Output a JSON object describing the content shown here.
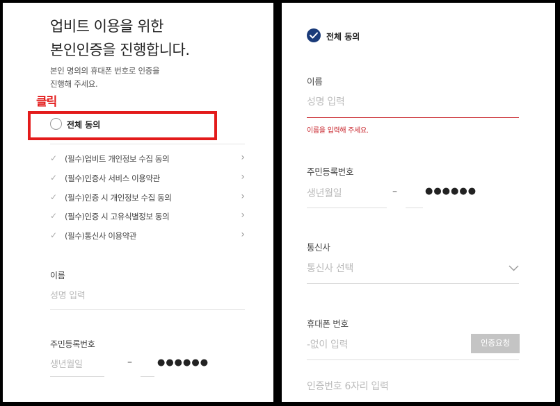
{
  "left": {
    "title_line1": "업비트 이용을 위한",
    "title_line2": "본인인증을 진행합니다.",
    "desc_line1": "본인 명의의 휴대폰 번호로 인증을",
    "desc_line2": "진행해 주세요.",
    "click_annotation": "클릭",
    "all_agree": "전체 동의",
    "terms": [
      "(필수)업비트 개인정보 수집 동의",
      "(필수)인증사 서비스 이용약관",
      "(필수)인증 시 개인정보 수집 동의",
      "(필수)인증 시 고유식별정보 동의",
      "(필수)통신사 이용약관"
    ],
    "name_label": "이름",
    "name_placeholder": "성명 입력",
    "rrn_label": "주민등록번호",
    "rrn_placeholder": "생년월일",
    "rrn_dash": "–",
    "rrn_masked": "●●●●●●"
  },
  "right": {
    "all_agree": "전체 동의",
    "name_label": "이름",
    "name_placeholder": "성명 입력",
    "name_error": "이름을 입력해 주세요.",
    "rrn_label": "주민등록번호",
    "rrn_placeholder": "생년월일",
    "rrn_dash": "–",
    "rrn_masked": "●●●●●●",
    "carrier_label": "통신사",
    "carrier_placeholder": "통신사 선택",
    "phone_label": "휴대폰 번호",
    "phone_placeholder": "-없이 입력",
    "verify_button": "인증요청",
    "code_placeholder": "인증번호 6자리 입력"
  },
  "colors": {
    "highlight_red": "#e31b1b",
    "error_red": "#c8252c",
    "check_navy": "#1a3b79",
    "button_gray": "#c4c4c4"
  },
  "icons": {
    "term_check": "checkmark-icon",
    "term_arrow": "chevron-right-icon",
    "carrier_dropdown": "chevron-down-icon",
    "all_agree_checked": "check-circle-icon",
    "all_agree_unchecked": "radio-circle-icon"
  }
}
